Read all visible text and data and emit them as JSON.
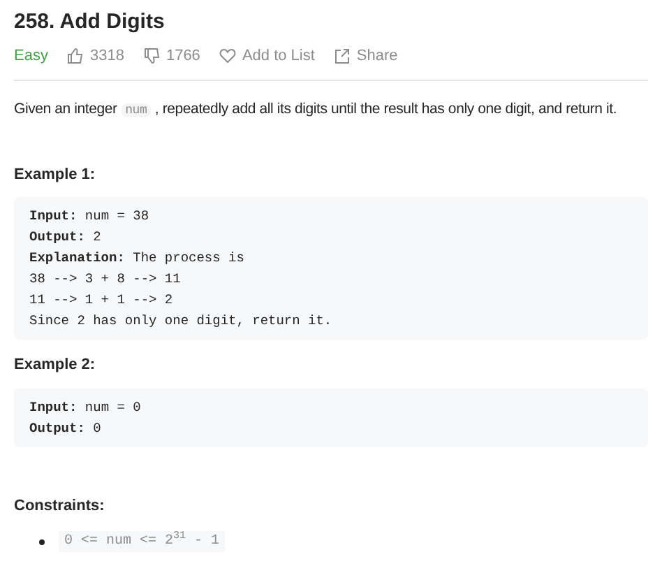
{
  "title": "258. Add Digits",
  "meta": {
    "difficulty": "Easy",
    "likes": "3318",
    "dislikes": "1766",
    "add_to_list": "Add to List",
    "share": "Share"
  },
  "description": [
    {
      "kind": "text",
      "text": "Given an integer "
    },
    {
      "kind": "code",
      "text": "num"
    },
    {
      "kind": "text",
      "text": " , repeatedly add all its digits until the result has only one digit, and return it."
    }
  ],
  "examples": [
    {
      "heading": "Example 1:",
      "lines": [
        "**Input:** num = 38",
        "**Output:** 2",
        "**Explanation:** The process is",
        "38 --> 3 + 8 --> 11",
        "11 --> 1 + 1 --> 2",
        "Since 2 has only one digit, return it."
      ]
    },
    {
      "heading": "Example 2:",
      "lines": [
        "**Input:** num = 0",
        "**Output:** 0"
      ]
    }
  ],
  "constraints": {
    "heading": "Constraints:",
    "items": [
      "0 <= num <= 2$^{31}$ - 1"
    ]
  }
}
